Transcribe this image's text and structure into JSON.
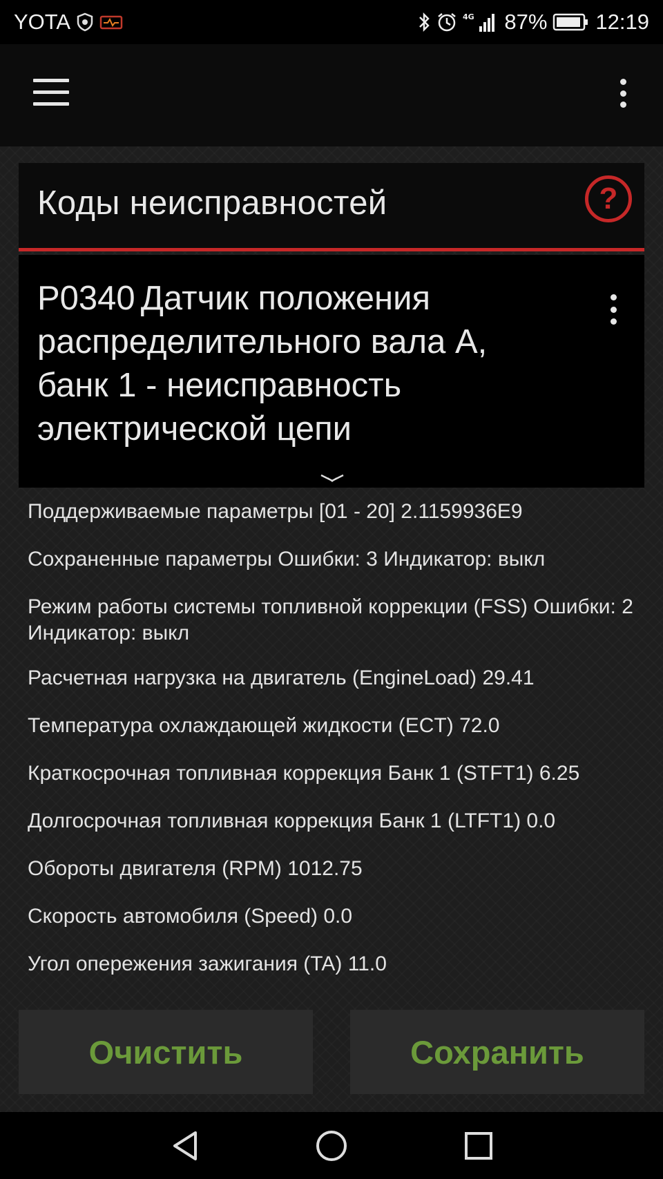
{
  "status_bar": {
    "carrier": "YOTA",
    "network": "4G",
    "battery": "87%",
    "time": "12:19"
  },
  "header": {
    "title": "Коды неисправностей",
    "help_symbol": "?"
  },
  "error": {
    "code": "P0340",
    "description": "Датчик положения распределительного вала А, банк 1 - неисправность электрической цепи"
  },
  "parameters": [
    "Поддерживаемые параметры [01 - 20] 2.1159936E9",
    "Сохраненные параметры Ошибки: 3 Индикатор: выкл",
    "Режим работы системы топливной коррекции (FSS) Ошибки: 2 Индикатор: выкл",
    "Расчетная нагрузка на двигатель (EngineLoad) 29.41",
    "Температура охлаждающей жидкости (ECT) 72.0",
    "Краткосрочная топливная коррекция Банк 1 (STFT1) 6.25",
    "Долгосрочная топливная коррекция Банк 1 (LTFT1) 0.0",
    "Обороты двигателя (RPM) 1012.75",
    "Скорость автомобиля (Speed) 0.0",
    "Угол опережения зажигания (TA) 11.0"
  ],
  "buttons": {
    "clear": "Очистить",
    "save": "Сохранить"
  },
  "colors": {
    "accent_red": "#c62828",
    "button_text_green": "#6b9a3a",
    "background": "#1e1e1e"
  }
}
